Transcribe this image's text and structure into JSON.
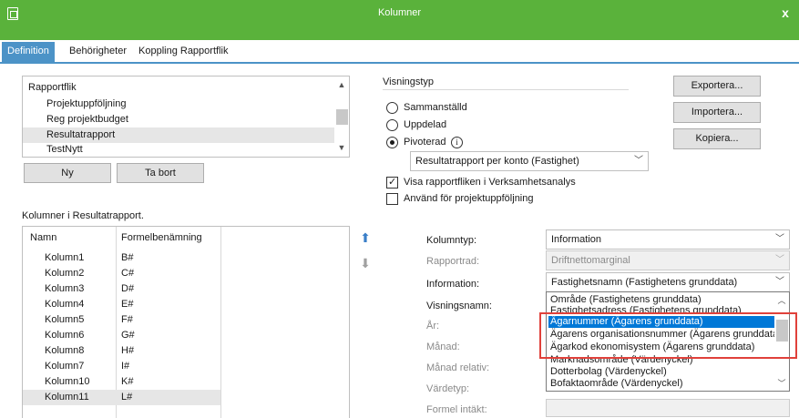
{
  "window": {
    "title": "Kolumner",
    "close": "x"
  },
  "tabs": [
    "Definition",
    "Behörigheter",
    "Koppling Rapportflik"
  ],
  "rapportflik": {
    "header": "Rapportflik",
    "items": [
      "Projektuppföljning",
      "Reg projektbudget",
      "Resultatrapport",
      "TestNytt"
    ],
    "selected": "Resultatrapport"
  },
  "buttons": {
    "new": "Ny",
    "delete": "Ta bort",
    "export": "Exportera...",
    "import": "Importera...",
    "copy": "Kopiera..."
  },
  "columns_section": {
    "title": "Kolumner i Resultatrapport.",
    "headers": [
      "Namn",
      "Formelbenämning"
    ],
    "rows": [
      {
        "name": "Kolumn1",
        "formula": "B#"
      },
      {
        "name": "Kolumn2",
        "formula": "C#"
      },
      {
        "name": "Kolumn3",
        "formula": "D#"
      },
      {
        "name": "Kolumn4",
        "formula": "E#"
      },
      {
        "name": "Kolumn5",
        "formula": "F#"
      },
      {
        "name": "Kolumn6",
        "formula": "G#"
      },
      {
        "name": "Kolumn8",
        "formula": "H#"
      },
      {
        "name": "Kolumn7",
        "formula": "I#"
      },
      {
        "name": "Kolumn10",
        "formula": "K#"
      },
      {
        "name": "Kolumn11",
        "formula": "L#"
      }
    ],
    "selected_row": "Kolumn11"
  },
  "visningstyp": {
    "label": "Visningstyp",
    "options": [
      "Sammanställd",
      "Uppdelad",
      "Pivoterad"
    ],
    "selected": "Pivoterad",
    "info_icon": "i",
    "pivot_combo": "Resultatrapport per konto (Fastighet)"
  },
  "checkboxes": [
    {
      "label": "Visa rapportfliken i Verksamhetsanalys",
      "checked": true
    },
    {
      "label": "Använd för projektuppföljning",
      "checked": false
    }
  ],
  "fields": {
    "kolumntyp": {
      "label": "Kolumntyp:",
      "value": "Information"
    },
    "rapportrad": {
      "label": "Rapportrad:",
      "value": "Driftnettomarginal"
    },
    "information": {
      "label": "Information:",
      "value": "Fastighetsnamn (Fastighetens grunddata)"
    },
    "visningsnamn": {
      "label": "Visningsnamn:"
    },
    "ar": {
      "label": "År:"
    },
    "manad": {
      "label": "Månad:"
    },
    "manad_relativ": {
      "label": "Månad relativ:"
    },
    "vardetyp": {
      "label": "Värdetyp:"
    },
    "formel_intakt": {
      "label": "Formel intäkt:"
    }
  },
  "dropdown_items": [
    "Område (Fastighetens grunddata)",
    "Fastighetsadress (Fastighetens grunddata)",
    "Ägarnummer (Ägarens grunddata)",
    "Ägarens organisationsnummer (Ägarens grunddata)",
    "Ägarkod ekonomisystem (Ägarens grunddata)",
    "Marknadsområde (Värdenyckel)",
    "Dotterbolag (Värdenyckel)",
    "Bofaktaområde (Värdenyckel)"
  ],
  "dropdown_selected": "Ägarnummer (Ägarens grunddata)",
  "colors": {
    "titlebar": "#5ab23b",
    "tab_active": "#4c93c7",
    "selection": "#0078d7",
    "highlight_border": "#e0413b"
  }
}
